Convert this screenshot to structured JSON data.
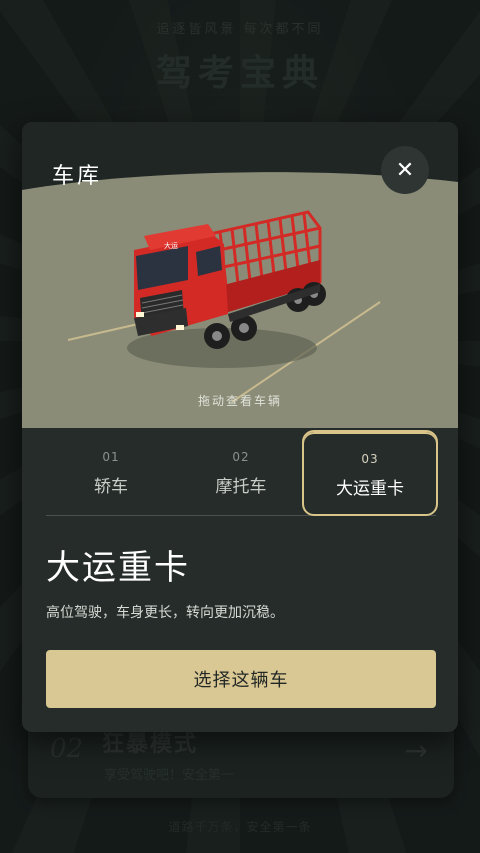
{
  "background": {
    "subtitle": "追逐皆风景  每次都不同",
    "title": "驾考宝典",
    "card": {
      "number": "02",
      "title": "狂暴模式",
      "subtitle": "享受驾驶吧！安全第一",
      "arrow": "→"
    },
    "footer": "道路千万条，安全第一条"
  },
  "modal": {
    "title": "车库",
    "close_symbol": "✕",
    "drag_hint": "拖动查看车辆",
    "truck_plate": "大运",
    "tabs": [
      {
        "num": "01",
        "label": "轿车",
        "active": false
      },
      {
        "num": "02",
        "label": "摩托车",
        "active": false
      },
      {
        "num": "03",
        "label": "大运重卡",
        "active": true
      }
    ],
    "selected_title": "大运重卡",
    "selected_description": "高位驾驶，车身更长，转向更加沉稳。",
    "select_button": "选择这辆车"
  },
  "colors": {
    "accent": "#d9c893",
    "truck_red": "#d42a26",
    "ground": "#8a8c77"
  },
  "icons": {
    "close": "close-icon",
    "arrow": "arrow-right-icon"
  }
}
